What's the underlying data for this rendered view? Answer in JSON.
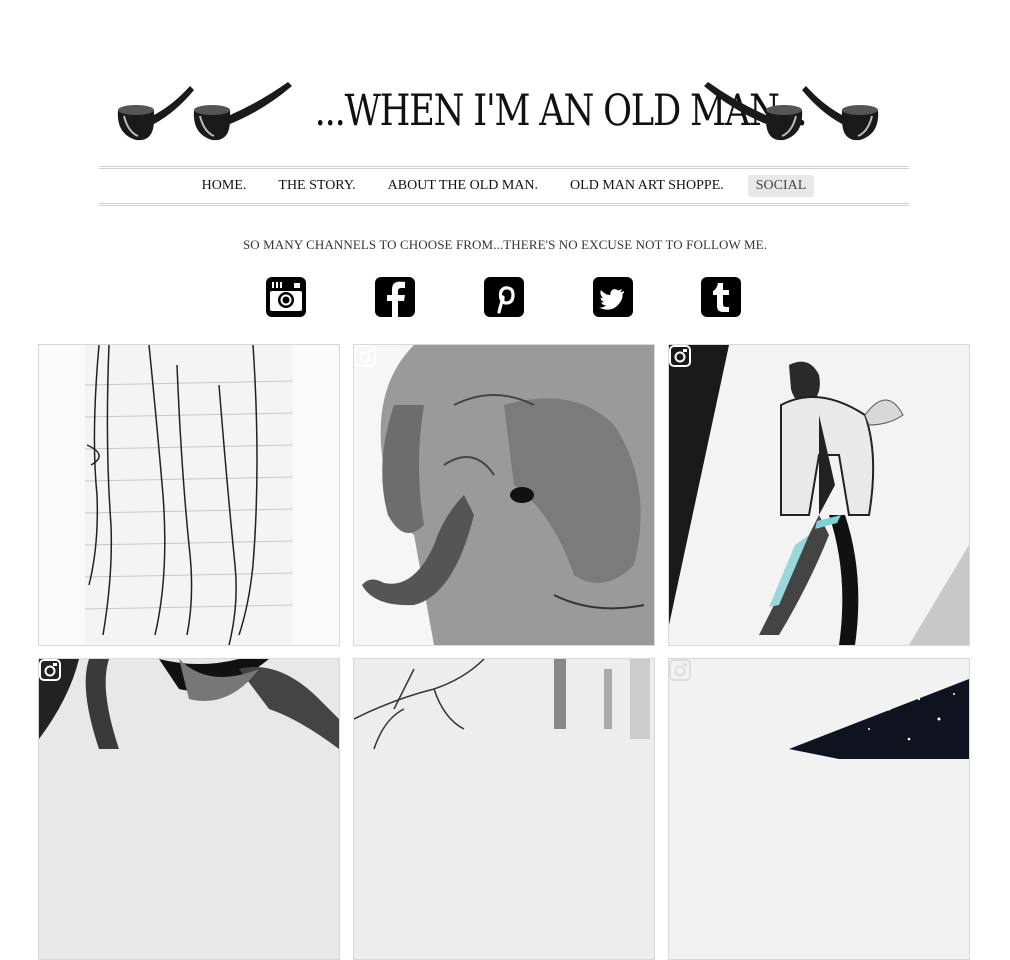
{
  "site": {
    "title": "...WHEN I'M AN OLD MAN..."
  },
  "nav": {
    "items": [
      {
        "label": "HOME."
      },
      {
        "label": "THE STORY."
      },
      {
        "label": "ABOUT THE OLD MAN."
      },
      {
        "label": "OLD MAN ART SHOPPE."
      },
      {
        "label": "SOCIAL"
      }
    ],
    "active_item": "SOCIAL"
  },
  "social": {
    "tagline": "SO MANY CHANNELS TO CHOOSE FROM...THERE'S NO EXCUSE NOT TO FOLLOW ME.",
    "icons": [
      "instagram-icon",
      "facebook-icon",
      "pinterest-icon",
      "twitter-icon",
      "tumblr-icon"
    ]
  },
  "gallery": {
    "tiles": [
      {
        "subject": "pencil sketch of legs on lined paper",
        "badge": false
      },
      {
        "subject": "elephant drawing",
        "badge": true
      },
      {
        "subject": "fashion sketch of figure in coat",
        "badge": true
      },
      {
        "subject": "abstract black brush strokes",
        "badge": true
      },
      {
        "subject": "bare tree branches",
        "badge": false
      },
      {
        "subject": "dark starry painting",
        "badge": true
      }
    ]
  },
  "colors": {
    "text": "#111111",
    "nav_active_bg": "#e8e8e8",
    "border": "#d8d8d8",
    "icon_bg": "#000000"
  }
}
